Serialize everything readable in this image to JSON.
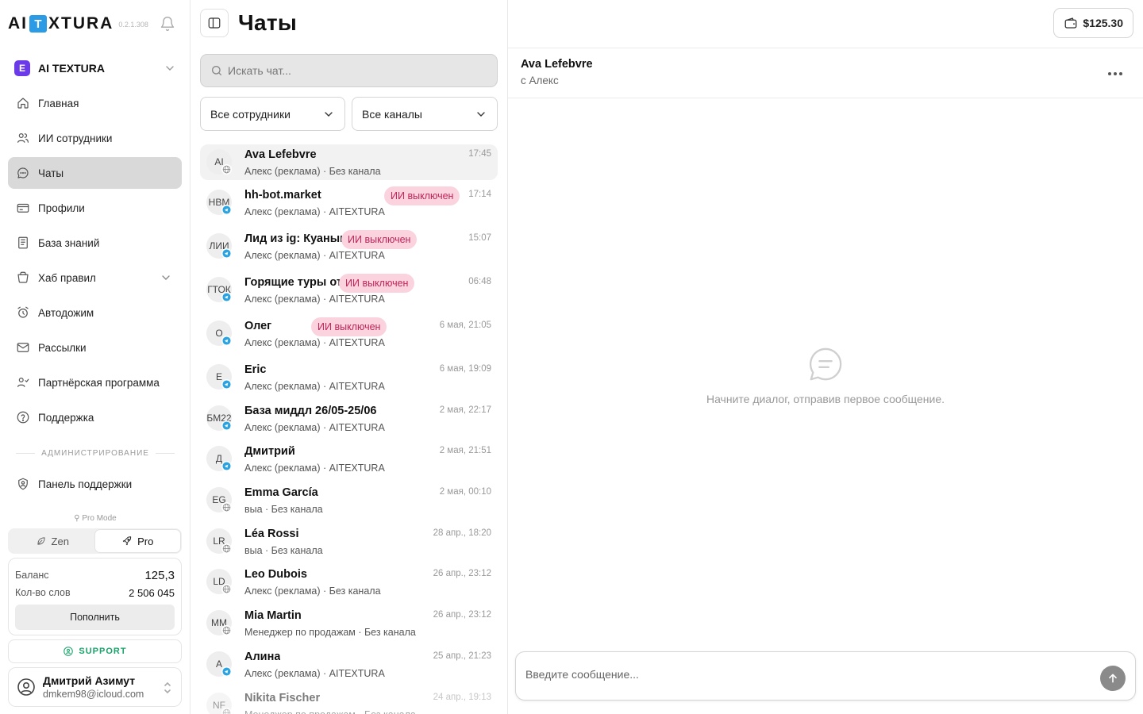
{
  "app": {
    "logo_left": "AI",
    "logo_box": "T",
    "logo_right": "XTURA",
    "version": "0.2.1.308"
  },
  "workspace": {
    "icon": "E",
    "name": "AI TEXTURA"
  },
  "nav": [
    {
      "label": "Главная",
      "icon": "home-icon"
    },
    {
      "label": "ИИ сотрудники",
      "icon": "users-icon"
    },
    {
      "label": "Чаты",
      "icon": "chat-icon",
      "active": true
    },
    {
      "label": "Профили",
      "icon": "wallet-card-icon"
    },
    {
      "label": "База знаний",
      "icon": "book-icon"
    },
    {
      "label": "Хаб правил",
      "icon": "rules-icon",
      "expandable": true
    },
    {
      "label": "Автодожим",
      "icon": "alarm-clock-icon"
    },
    {
      "label": "Рассылки",
      "icon": "mail-icon"
    },
    {
      "label": "Партнёрская программа",
      "icon": "partner-icon"
    },
    {
      "label": "Поддержка",
      "icon": "help-icon"
    }
  ],
  "admin": {
    "section_label": "АДМИНИСТРИРОВАНИЕ",
    "support_panel": "Панель поддержки"
  },
  "mode": {
    "label": "Pro Mode",
    "zen": "Zen",
    "pro": "Pro",
    "selected": "Pro"
  },
  "balance": {
    "balance_label": "Баланс",
    "balance_value": "125,3",
    "words_label": "Кол-во слов",
    "words_value": "2 506 045",
    "topup": "Пополнить"
  },
  "support_button": "SUPPORT",
  "user": {
    "name": "Дмитрий Азимут",
    "email": "dmkem98@icloud.com"
  },
  "header": {
    "title": "Чаты"
  },
  "search": {
    "placeholder": "Искать чат..."
  },
  "filters": {
    "employees": "Все сотрудники",
    "channels": "Все каналы"
  },
  "chats": [
    {
      "initials": "AI",
      "name": "Ava Lefebvre",
      "sub": "Алекс (реклама) · Без канала",
      "time": "17:45",
      "channel": "web",
      "ai_off": false
    },
    {
      "initials": "HBM",
      "name": "hh-bot.market",
      "sub": "Алекс (реклама) · AITEXTURA",
      "time": "17:14",
      "channel": "telegram",
      "ai_off": true
    },
    {
      "initials": "ЛИИ",
      "name": "Лид из ig: Куаныш Тел...",
      "sub": "Алекс (реклама) · AITEXTURA",
      "time": "15:07",
      "channel": "telegram",
      "ai_off": true
    },
    {
      "initials": "ГТОК",
      "name": "Горящие туры от Кem...",
      "sub": "Алекс (реклама) · AITEXTURA",
      "time": "06:48",
      "channel": "telegram",
      "ai_off": true
    },
    {
      "initials": "О",
      "name": "Олег",
      "sub": "Алекс (реклама) · AITEXTURA",
      "time": "6 мая, 21:05",
      "channel": "telegram",
      "ai_off": true
    },
    {
      "initials": "E",
      "name": "Eric",
      "sub": "Алекс (реклама) · AITEXTURA",
      "time": "6 мая, 19:09",
      "channel": "telegram",
      "ai_off": false
    },
    {
      "initials": "БМ22",
      "name": "База миддл 26/05-25/06",
      "sub": "Алекс (реклама) · AITEXTURA",
      "time": "2 мая, 22:17",
      "channel": "telegram",
      "ai_off": false
    },
    {
      "initials": "Д",
      "name": "Дмитрий",
      "sub": "Алекс (реклама) · AITEXTURA",
      "time": "2 мая, 21:51",
      "channel": "telegram",
      "ai_off": false
    },
    {
      "initials": "EG",
      "name": "Emma García",
      "sub": "выа · Без канала",
      "time": "2 мая, 00:10",
      "channel": "web",
      "ai_off": false
    },
    {
      "initials": "LR",
      "name": "Léa Rossi",
      "sub": "выа · Без канала",
      "time": "28 апр., 18:20",
      "channel": "web",
      "ai_off": false
    },
    {
      "initials": "LD",
      "name": "Leo Dubois",
      "sub": "Алекс (реклама) · Без канала",
      "time": "26 апр., 23:12",
      "channel": "web",
      "ai_off": false
    },
    {
      "initials": "MM",
      "name": "Mia Martin",
      "sub": "Менеджер по продажам · Без канала",
      "time": "26 апр., 23:12",
      "channel": "web",
      "ai_off": false
    },
    {
      "initials": "А",
      "name": "Алина",
      "sub": "Алекс (реклама) · AITEXTURA",
      "time": "25 апр., 21:23",
      "channel": "telegram",
      "ai_off": false
    },
    {
      "initials": "NF",
      "name": "Nikita Fischer",
      "sub": "Менеджер по продажам · Без канала",
      "time": "24 апр., 19:13",
      "channel": "web",
      "ai_off": false
    }
  ],
  "ai_off_label": "ИИ выключен",
  "wallet": {
    "amount": "$125.30"
  },
  "conversation": {
    "name": "Ava Lefebvre",
    "sub": "с Алекс",
    "empty_text": "Начните диалог, отправив первое сообщение."
  },
  "composer": {
    "placeholder": "Введите сообщение..."
  },
  "colors": {
    "accent_purple": "#6b3bea",
    "logo_blue": "#2b9be6",
    "ai_off_bg": "#fbd3de",
    "ai_off_text": "#c2245a",
    "support_green": "#1aa36a"
  }
}
